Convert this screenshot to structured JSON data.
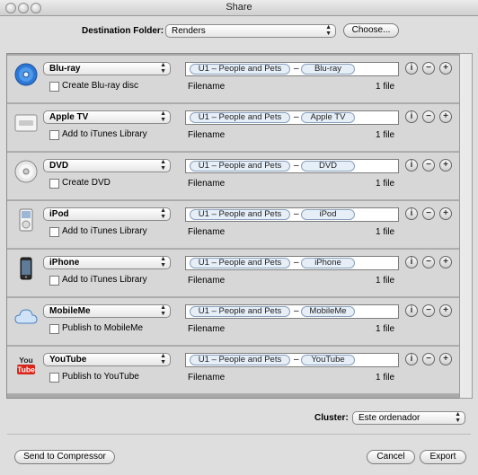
{
  "window": {
    "title": "Share"
  },
  "destination": {
    "label": "Destination Folder:",
    "value": "Renders",
    "choose_label": "Choose..."
  },
  "rows": [
    {
      "icon": "bluray-disc-icon",
      "target": "Blu-ray",
      "option": "Create Blu-ray disc",
      "token_source": "U1 – People and Pets",
      "token_suffix": "Blu-ray",
      "filename_label": "Filename",
      "count": "1 file"
    },
    {
      "icon": "apple-tv-icon",
      "target": "Apple TV",
      "option": "Add to iTunes Library",
      "token_source": "U1 – People and Pets",
      "token_suffix": "Apple TV",
      "filename_label": "Filename",
      "count": "1 file"
    },
    {
      "icon": "dvd-disc-icon",
      "target": "DVD",
      "option": "Create DVD",
      "token_source": "U1 – People and Pets",
      "token_suffix": "DVD",
      "filename_label": "Filename",
      "count": "1 file"
    },
    {
      "icon": "ipod-icon",
      "target": "iPod",
      "option": "Add to iTunes Library",
      "token_source": "U1 – People and Pets",
      "token_suffix": "iPod",
      "filename_label": "Filename",
      "count": "1 file"
    },
    {
      "icon": "iphone-icon",
      "target": "iPhone",
      "option": "Add to iTunes Library",
      "token_source": "U1 – People and Pets",
      "token_suffix": "iPhone",
      "filename_label": "Filename",
      "count": "1 file"
    },
    {
      "icon": "mobileme-cloud-icon",
      "target": "MobileMe",
      "option": "Publish to MobileMe",
      "token_source": "U1 – People and Pets",
      "token_suffix": "MobileMe",
      "filename_label": "Filename",
      "count": "1 file"
    },
    {
      "icon": "youtube-icon",
      "target": "YouTube",
      "option": "Publish to YouTube",
      "token_source": "U1 – People and Pets",
      "token_suffix": "YouTube",
      "filename_label": "Filename",
      "count": "1 file"
    }
  ],
  "row_buttons": {
    "info": "i",
    "remove": "−",
    "add": "+"
  },
  "youtube_logo_text": {
    "top": "You",
    "bottom": "Tube"
  },
  "cluster": {
    "label": "Cluster:",
    "value": "Este ordenador"
  },
  "footer": {
    "send_label": "Send to Compressor",
    "cancel_label": "Cancel",
    "export_label": "Export"
  },
  "colors": {
    "token_fill": "#e6eef8",
    "youtube_red": "#d8261b",
    "list_bg": "#d7d7d7"
  }
}
